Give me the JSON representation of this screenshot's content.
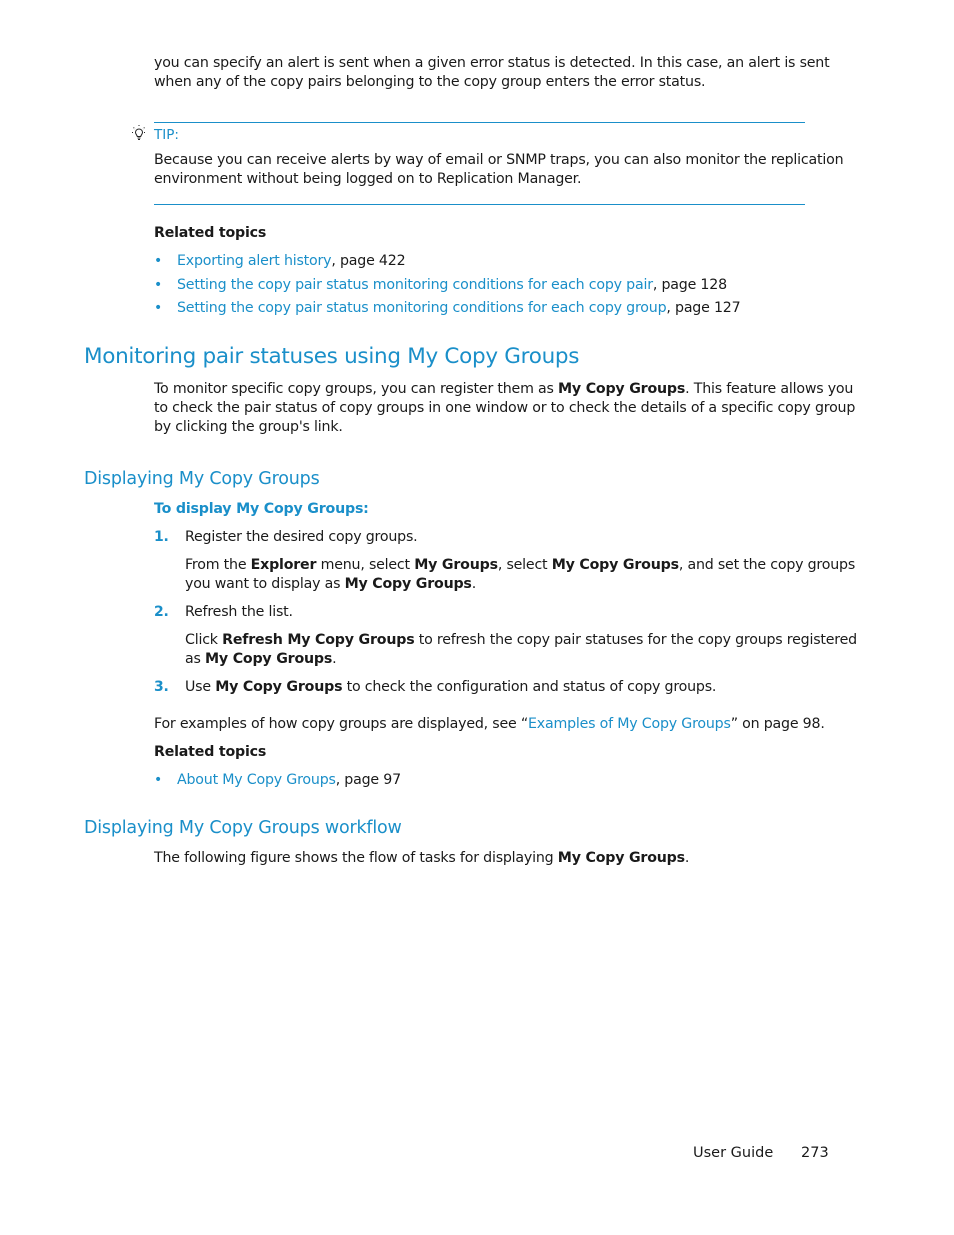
{
  "intro_paragraph": {
    "line1": "you can specify an alert is sent when a given error status is detected. In this case, an alert is sent",
    "line2": "when any of the copy pairs belonging to the copy group enters the error status."
  },
  "tip": {
    "icon": "lightbulb-icon",
    "label": "TIP:",
    "line1": "Because you can receive alerts by way of email or SNMP traps, you can also monitor the replication",
    "line2": "environment without being logged on to Replication Manager."
  },
  "related_topics_1": {
    "heading": "Related topics",
    "items": [
      {
        "link": "Exporting alert history",
        "suffix": ", page 422"
      },
      {
        "link": "Setting the copy pair status monitoring conditions for each copy pair",
        "suffix": ", page 128"
      },
      {
        "link": "Setting the copy pair status monitoring conditions for each copy group",
        "suffix": ", page 127"
      }
    ]
  },
  "section_monitoring": {
    "title": "Monitoring pair statuses using My Copy Groups",
    "para": {
      "l1_pre": "To monitor specific copy groups, you can register them as ",
      "l1_bold": "My Copy Groups",
      "l1_post": ". This feature allows you",
      "l2": "to check the pair status of copy groups in one window or to check the details of a specific copy group",
      "l3": "by clicking the group's link."
    }
  },
  "section_displaying": {
    "title": "Displaying My Copy Groups",
    "procedure_title": "To display My Copy Groups:",
    "steps": [
      {
        "number": "1.",
        "text": "Register the desired copy groups.",
        "detail": {
          "p1": "From the ",
          "b1": "Explorer",
          "p2": " menu, select ",
          "b2": "My Groups",
          "p3": ", select ",
          "b3": "My Copy Groups",
          "p4": ", and set the copy groups",
          "p5": "you want to display as ",
          "b4": "My Copy Groups",
          "p6": "."
        }
      },
      {
        "number": "2.",
        "text": "Refresh the list.",
        "detail": {
          "p1": "Click ",
          "b1": "Refresh My Copy Groups",
          "p2": " to refresh the copy pair statuses for the copy groups registered",
          "p3": "as ",
          "b2": "My Copy Groups",
          "p4": "."
        }
      },
      {
        "number": "3.",
        "pre": "Use ",
        "bold": "My Copy Groups",
        "post": " to check the configuration and status of copy groups."
      }
    ],
    "examples": {
      "pre": "For examples of how copy groups are displayed, see “",
      "link": "Examples of My Copy Groups",
      "post": "” on page 98."
    },
    "related_heading": "Related topics",
    "related_items": [
      {
        "link": "About My Copy Groups",
        "suffix": ", page 97"
      }
    ]
  },
  "section_workflow": {
    "title": "Displaying My Copy Groups workflow",
    "pre": "The following figure shows the flow of tasks for displaying ",
    "bold": "My Copy Groups",
    "post": "."
  },
  "footer": {
    "guide_label": "User Guide",
    "page_number": "273"
  }
}
